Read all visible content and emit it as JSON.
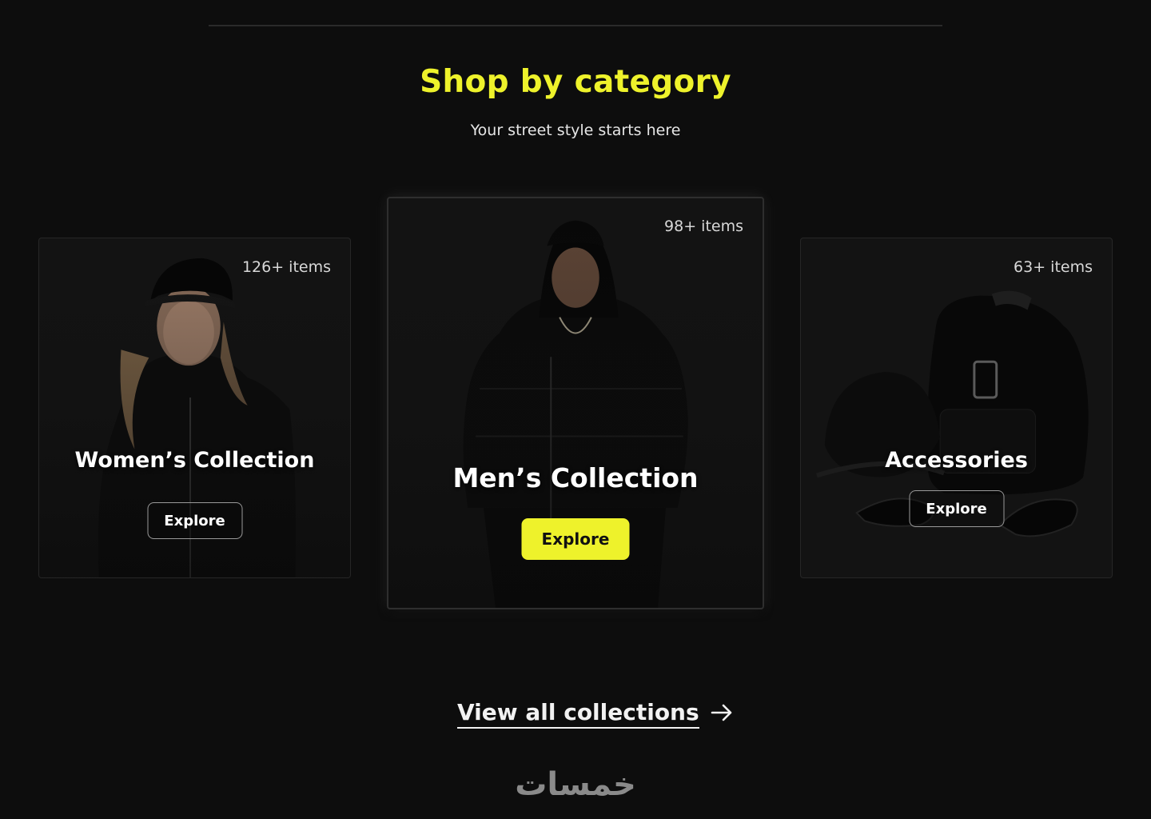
{
  "section": {
    "title": "Shop by category",
    "subtitle": "Your street style starts here"
  },
  "cards": [
    {
      "title": "Women’s Collection",
      "count": "126+ items",
      "button": "Explore"
    },
    {
      "title": "Men’s Collection",
      "count": "98+ items",
      "button": "Explore"
    },
    {
      "title": "Accessories",
      "count": "63+ items",
      "button": "Explore"
    }
  ],
  "view_all": {
    "label": "View all collections",
    "icon": "arrow-right-icon"
  },
  "watermark": "خمسات",
  "colors": {
    "accent": "#eef22b",
    "background": "#0d0d0d",
    "card": "#131313"
  }
}
